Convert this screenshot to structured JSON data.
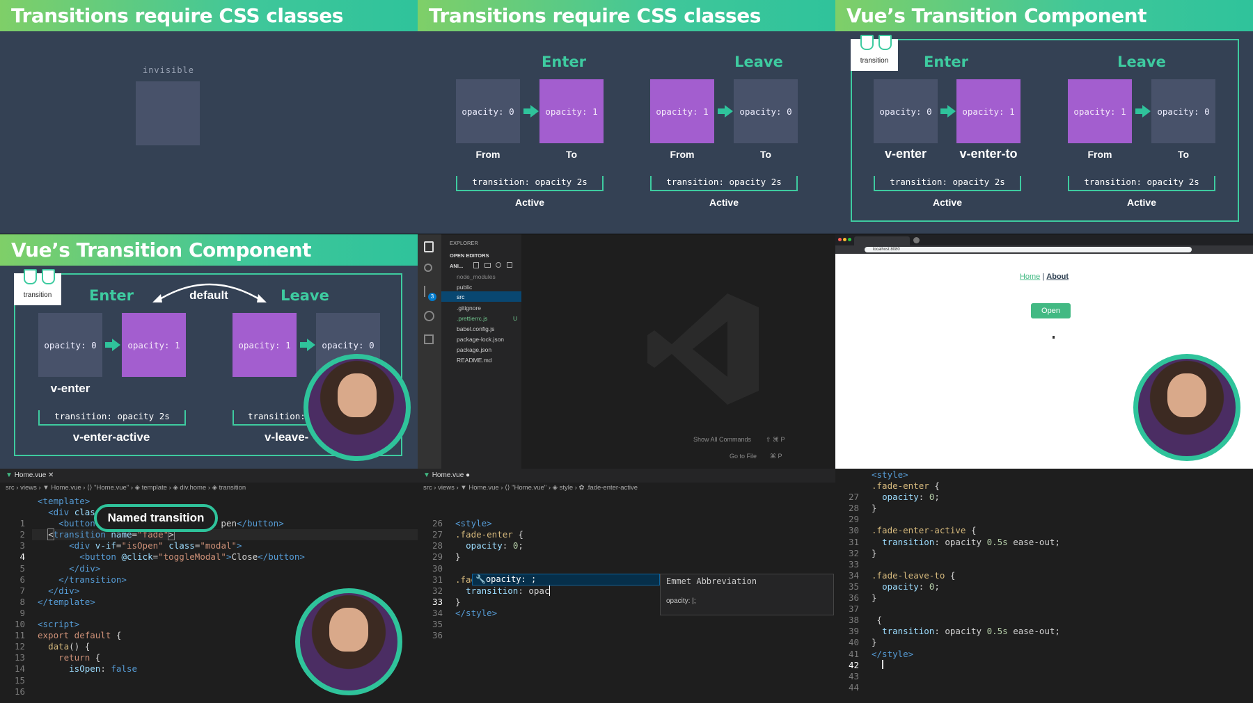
{
  "p1": {
    "title": "Transitions require CSS classes",
    "box_label": "invisible"
  },
  "p2": {
    "title": "Transitions require CSS classes",
    "enter": "Enter",
    "leave": "Leave",
    "o0": "opacity: 0",
    "o1": "opacity: 1",
    "from": "From",
    "to": "To",
    "trans": "transition: opacity 2s",
    "active": "Active"
  },
  "p3": {
    "title": "Vue’s Transition Component",
    "tab": "transition",
    "enter": "Enter",
    "leave": "Leave",
    "o0": "opacity: 0",
    "o1": "opacity: 1",
    "v_enter": "v-enter",
    "v_enter_to": "v-enter-to",
    "from": "From",
    "to": "To",
    "trans": "transition: opacity 2s",
    "active": "Active"
  },
  "p4": {
    "title_a": "Vue’s ",
    "title_b": "Transition Component",
    "tab": "transition",
    "enter": "Enter",
    "leave": "Leave",
    "default": "default",
    "o0": "opacity: 0",
    "o1": "opacity: 1",
    "v_enter": "v-enter",
    "trans": "transition: opacity 2s",
    "trans_cut": "transition: ",
    "v_enter_active": "v-enter-active",
    "v_leave": "v-leave-"
  },
  "vsc": {
    "explorer": "EXPLORER",
    "open_editors": "OPEN EDITORS",
    "project": "ANI...",
    "files": [
      "node_modules",
      "public",
      "src",
      ".gitignore",
      ".prettierrc.js",
      "babel.config.js",
      "package-lock.json",
      "package.json",
      "README.md"
    ],
    "badge": "3",
    "u": "U",
    "show_all": "Show All Commands",
    "goto": "Go to File",
    "k1": "⇧ ⌘ P",
    "k2": "⌘ P"
  },
  "browser": {
    "url": "localhost:8080",
    "home": "Home",
    "sep": "|",
    "about": "About",
    "open": "Open"
  },
  "e1": {
    "tab": "Home.vue",
    "crumb": "src › views › ▼ Home.vue › ⟨⟩ \"Home.vue\" › ◈ template › ◈ div.home › ◈ transition",
    "bubble": "Named transition",
    "lines": [
      "1",
      "2",
      "3",
      "4",
      "5",
      "6",
      "7",
      "8",
      "9",
      "10",
      "11",
      "12",
      "13",
      "14",
      "15",
      "16"
    ]
  },
  "e2": {
    "tab": "Home.vue",
    "crumb": "src › views › ▼ Home.vue › ⟨⟩ \"Home.vue\" › ◈ style › ✿ .fade-enter-active",
    "lines": [
      "26",
      "27",
      "28",
      "29",
      "30",
      "31",
      "32",
      "33",
      "34",
      "35",
      "36"
    ],
    "suggest": "opacity: ;",
    "emmet": "Emmet Abbreviation",
    "emmet_val": "opacity: |;"
  },
  "e3": {
    "lines": [
      "27",
      "28",
      "29",
      "30",
      "31",
      "32",
      "33",
      "34",
      "35",
      "36",
      "37",
      "38",
      "39",
      "40",
      "41",
      "42",
      "43",
      "44"
    ]
  }
}
